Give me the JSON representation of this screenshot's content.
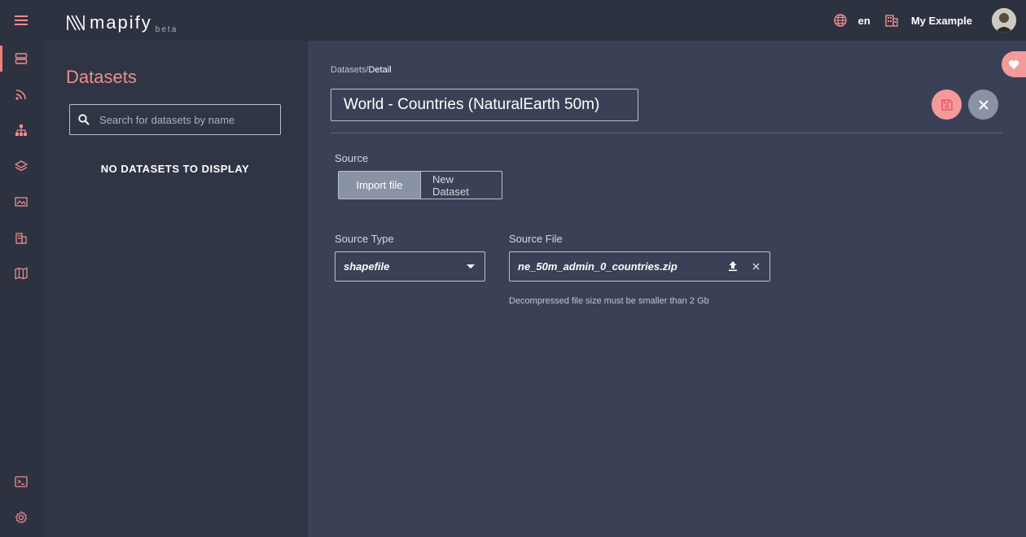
{
  "app": {
    "logo_text": "mapify",
    "logo_tag": "beta"
  },
  "header": {
    "language": "en",
    "organization": "My Example"
  },
  "rail": {
    "items": [
      "datasets-icon",
      "feed-icon",
      "hierarchy-icon",
      "layers-icon",
      "image-icon",
      "buildings-icon",
      "map-icon"
    ],
    "bottom_items": [
      "terminal-icon",
      "gear-icon"
    ],
    "active_index": 0
  },
  "list_panel": {
    "title": "Datasets",
    "search_placeholder": "Search for datasets by name",
    "empty_message": "NO DATASETS TO DISPLAY"
  },
  "detail": {
    "breadcrumb_parent": "Datasets",
    "breadcrumb_separator": "/",
    "breadcrumb_current": "Detail",
    "dataset_name": "World - Countries (NaturalEarth 50m)",
    "source_label": "Source",
    "source_options": [
      "Import file",
      "New Dataset"
    ],
    "source_selected": "Import file",
    "source_type_label": "Source Type",
    "source_type_value": "shapefile",
    "source_file_label": "Source File",
    "source_file_value": "ne_50m_admin_0_countries.zip",
    "hint": "Decompressed file size must be smaller than 2 Gb"
  },
  "colors": {
    "accent": "#f08d8d",
    "topbar": "#2d3240",
    "panel": "#2f3545",
    "detail": "#3a4156"
  }
}
